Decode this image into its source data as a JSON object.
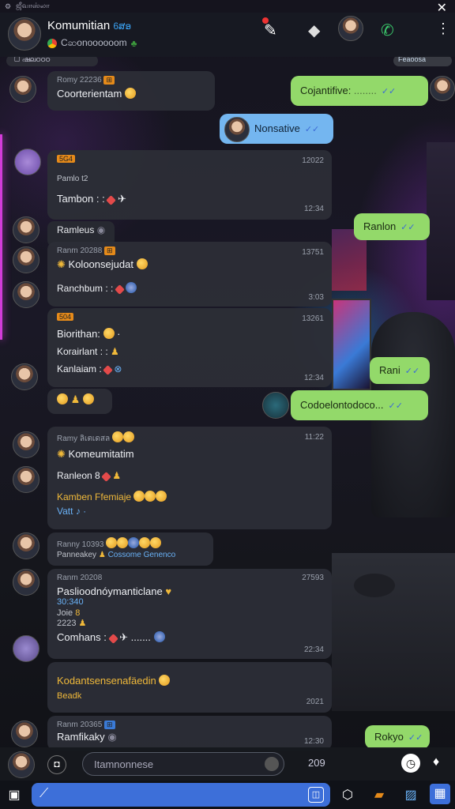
{
  "status_bar": {
    "left_text": "ஜீவாஸ்லா"
  },
  "header": {
    "title": "Komumitian",
    "title_tag": "6ສອ",
    "subtitle": "Cဆonoooooom"
  },
  "messages": {
    "m1_meta": "Romy 22236",
    "m1_text": "Coorterientam",
    "m2_text": "Cojantifive:",
    "m3_text": "Nonsative",
    "m4_badge": "5G4",
    "m4_time": "12022",
    "m4_l1": "Pamlo t2",
    "m4_l2": "Tambon : :",
    "m4_time2": "12:34",
    "sys1": "Ramleus",
    "m5_text": "Ranlon",
    "m6_meta": "Ranm 20288",
    "m6_time": "13751",
    "m6_l1": "Koloonsejudat",
    "m6_l2": "Ranchbum : :",
    "m6_time2": "3:03",
    "m7_badge": "504",
    "m7_time": "13261",
    "m7_l1": "Biorithan:",
    "m7_l2": "Korairlant : :",
    "m7_l3": "Kanlaiam :",
    "m7_time2": "12:34",
    "m8_text": "Rani",
    "m9_text": "Codoelontodoco...",
    "m10_meta": "Ramy ลิเตเดสล",
    "m10_time": "11:22",
    "m10_l1": "Komeumitatim",
    "m10_l2": "Ranleon 8",
    "m10_l3": "Kamben Ffemiaje",
    "m10_l4": "Vatt",
    "m11_meta": "Ranny 10393",
    "m11_sub": "Panneakey",
    "m11_link": "Cossome Genenco",
    "m12_meta": "Ranm 20208",
    "m12_time": "27593",
    "m12_l1": "Paslioodnóymanticlane",
    "m12_l2": "30:340",
    "m12_l3": "Joie",
    "m12_l4": "2223",
    "m12_l5": "Comhans :",
    "m12_time2": "22:34",
    "m13_l1": "Kodantsensenafäedin",
    "m13_l2": "Beadk",
    "m13_time": "2021",
    "m14_meta": "Ranm 20365",
    "m14_l1": "Ramfikaky",
    "m14_time": "12:30",
    "m15_text": "Rokyo"
  },
  "input_bar": {
    "placeholder": "Itamnonnese",
    "counter": "209"
  },
  "colors": {
    "accent": "#3d6fd9",
    "outgoing_green": "#93d96a",
    "outgoing_blue": "#74b6f0",
    "bubble": "#2c2e36"
  }
}
